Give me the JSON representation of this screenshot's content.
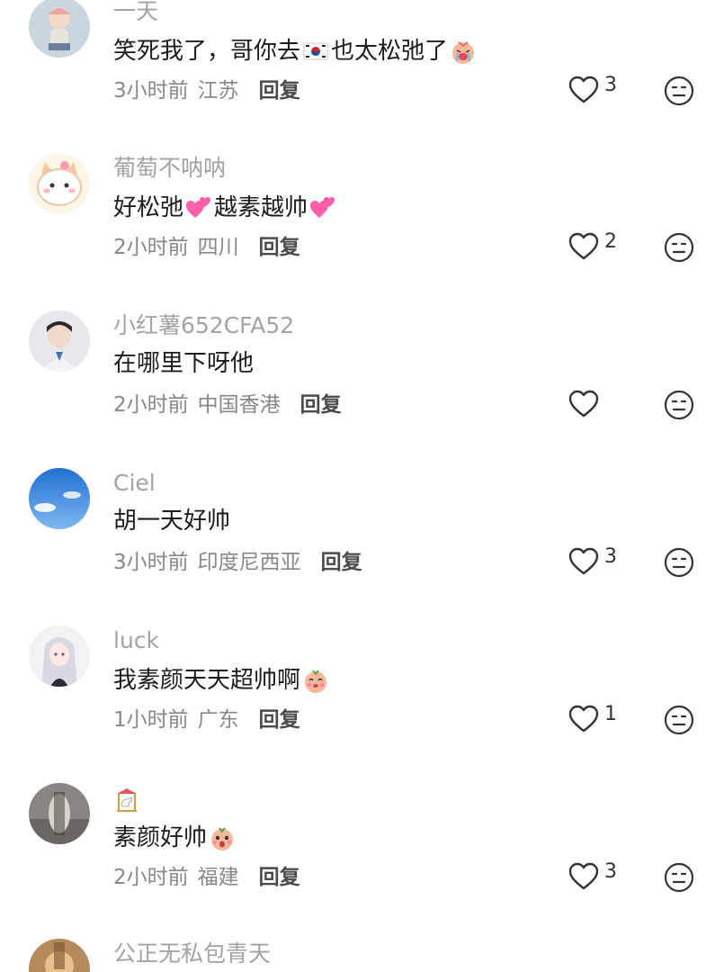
{
  "comments": [
    {
      "username": "一天",
      "text_parts": [
        "笑死我了，哥你去",
        "也太松弛了",
        ""
      ],
      "time": "3小时前",
      "location": "江苏",
      "reply": "回复",
      "likes": "3"
    },
    {
      "username": "葡萄不呐呐",
      "text_parts": [
        "好松弛",
        "越素越帅",
        ""
      ],
      "time": "2小时前",
      "location": "四川",
      "reply": "回复",
      "likes": "2"
    },
    {
      "username": "小红薯652CFA52",
      "text_parts": [
        "在哪里下呀他"
      ],
      "time": "2小时前",
      "location": "中国香港",
      "reply": "回复",
      "likes": ""
    },
    {
      "username": "Ciel",
      "text_parts": [
        "胡一天好帅"
      ],
      "time": "3小时前",
      "location": "印度尼西亚",
      "reply": "回复",
      "likes": "3"
    },
    {
      "username": "luck",
      "text_parts": [
        "我素颜天天超帅啊",
        ""
      ],
      "time": "1小时前",
      "location": "广东",
      "reply": "回复",
      "likes": "1"
    },
    {
      "username": "",
      "text_parts": [
        "素颜好帅",
        ""
      ],
      "time": "2小时前",
      "location": "福建",
      "reply": "回复",
      "likes": "3"
    },
    {
      "username": "公正无私包青天"
    }
  ],
  "icons": {
    "like": "heart-outline-icon",
    "dislike": "neutral-face-icon"
  },
  "colors": {
    "username": "#a3a3a3",
    "text": "#1c1c1c",
    "meta": "#888888",
    "heart_emoji": "#ff5fa8"
  }
}
